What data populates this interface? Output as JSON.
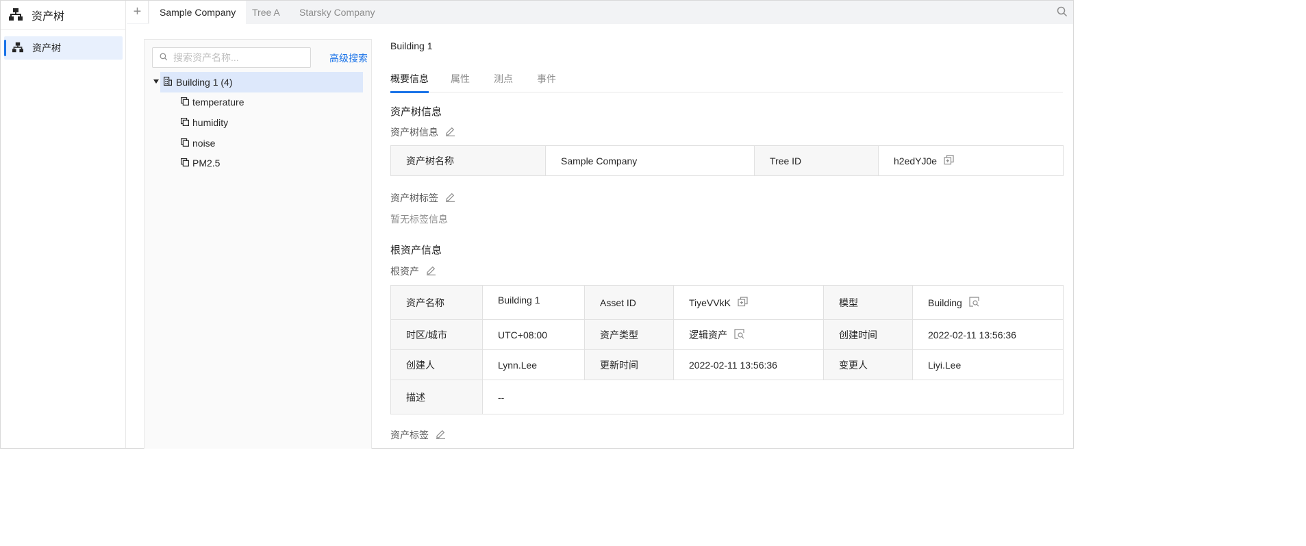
{
  "nav": {
    "brand_label": "资产树",
    "items": [
      {
        "label": "资产树"
      }
    ]
  },
  "top_tabs": {
    "add_symbol": "+",
    "tabs": [
      {
        "label": "Sample Company",
        "active": true
      },
      {
        "label": "Tree A"
      },
      {
        "label": "Starsky Company"
      }
    ]
  },
  "tree": {
    "search_placeholder": "搜索资产名称...",
    "advanced_search": "高级搜索",
    "root": {
      "label": "Building 1 (4)"
    },
    "children": [
      {
        "label": "temperature"
      },
      {
        "label": "humidity"
      },
      {
        "label": "noise"
      },
      {
        "label": "PM2.5"
      }
    ]
  },
  "detail": {
    "breadcrumb": "Building 1",
    "tabs": [
      {
        "label": "概要信息",
        "active": true
      },
      {
        "label": "属性"
      },
      {
        "label": "测点"
      },
      {
        "label": "事件"
      }
    ],
    "tree_section": {
      "title": "资产树信息",
      "info_label": "资产树信息",
      "name_key": "资产树名称",
      "name_value": "Sample Company",
      "id_key": "Tree ID",
      "id_value": "h2edYJ0e",
      "tags_label": "资产树标签",
      "tags_empty": "暂无标签信息"
    },
    "root_section": {
      "title": "根资产信息",
      "root_label": "根资产",
      "rows": {
        "asset_name_key": "资产名称",
        "asset_name_value": "Building 1",
        "asset_id_key": "Asset ID",
        "asset_id_value": "TiyeVVkK",
        "model_key": "模型",
        "model_value": "Building",
        "timezone_key": "时区/城市",
        "timezone_value": "UTC+08:00",
        "asset_type_key": "资产类型",
        "asset_type_value": "逻辑资产",
        "created_time_key": "创建时间",
        "created_time_value": "2022-02-11 13:56:36",
        "creator_key": "创建人",
        "creator_value": "Lynn.Lee",
        "updated_time_key": "更新时间",
        "updated_time_value": "2022-02-11 13:56:36",
        "modifier_key": "变更人",
        "modifier_value": "Liyi.Lee",
        "desc_key": "描述",
        "desc_value": "--"
      },
      "asset_tags_label": "资产标签"
    }
  },
  "colors": {
    "accent": "#1a73e8",
    "selected_bg": "#dde8fb"
  }
}
